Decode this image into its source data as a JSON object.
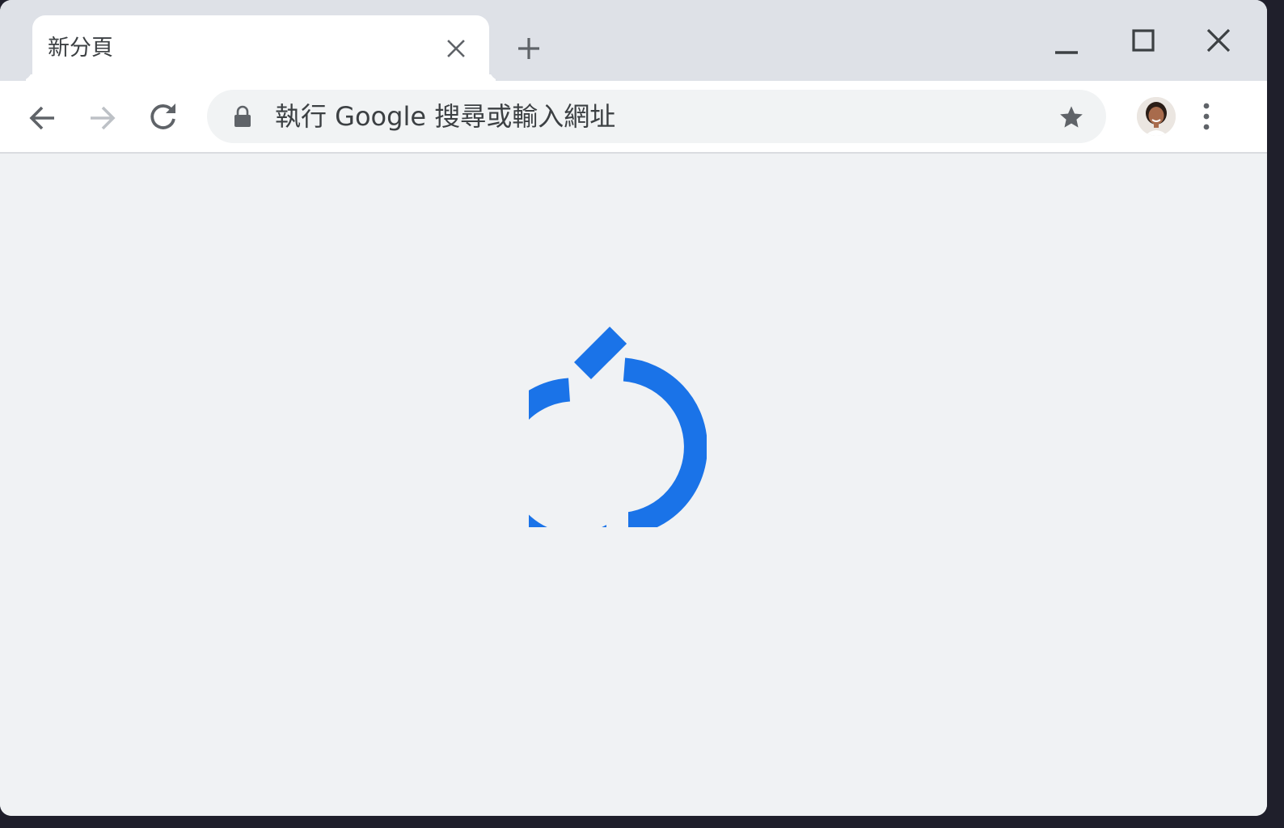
{
  "tab": {
    "title": "新分頁",
    "close_icon": "close-icon"
  },
  "tabstrip": {
    "new_tab_icon": "plus-icon"
  },
  "window_controls": {
    "minimize_icon": "minimize-icon",
    "maximize_icon": "maximize-icon",
    "close_icon": "close-icon"
  },
  "toolbar": {
    "back_icon": "arrow-left-icon",
    "forward_icon": "arrow-right-icon",
    "reload_icon": "reload-icon",
    "menu_icon": "more-vertical-icon"
  },
  "omnibox": {
    "placeholder": "執行 Google 搜尋或輸入網址",
    "security_icon": "lock-icon",
    "bookmark_icon": "star-icon"
  },
  "content": {
    "illustration_icon": "reload-icon"
  },
  "colors": {
    "accent": "#1a73e8",
    "tabstrip_bg": "#dee1e7",
    "content_bg": "#f0f2f4",
    "text": "#3c4043",
    "icon": "#5f6368",
    "disabled_icon": "#bdc1c6"
  }
}
